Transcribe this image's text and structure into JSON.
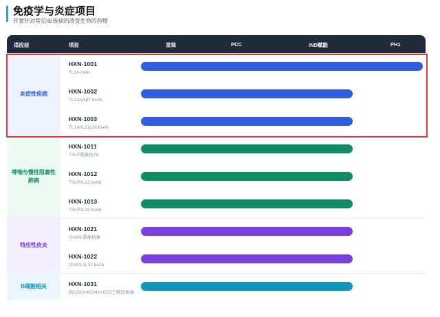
{
  "header": {
    "title": "免疫学与炎症项目",
    "subtitle": "开发针对常见I&I疾病的改变生命的药物"
  },
  "table": {
    "columns": {
      "indication": "适应症",
      "project": "项目",
      "discovery": "发现",
      "pcc": "PCC",
      "ind": "IND赋能",
      "ph1": "PH1"
    },
    "groups": [
      {
        "label": "炎症性疾病",
        "color": "#2f5fe0",
        "bg": "#eef3ff",
        "items": [
          {
            "code": "HXN-1001",
            "target": "TL1A mAb",
            "stage_progress": 1.0
          },
          {
            "code": "HXN-1002",
            "target": "TL1A/α4β7 bsAb",
            "stage_progress": 0.75
          },
          {
            "code": "HXN-1003",
            "target": "TL1A/IL23p19 bsAb",
            "stage_progress": 0.75
          }
        ]
      },
      {
        "label": "哮喘与慢性阻塞性肺病",
        "color": "#0f8c63",
        "bg": "#ecfaf3",
        "items": [
          {
            "code": "HXN-1011",
            "target": "TSLP双表位Ab",
            "stage_progress": 0.75
          },
          {
            "code": "HXN-1012",
            "target": "TSLP/IL13 bsAb",
            "stage_progress": 0.75
          },
          {
            "code": "HXN-1013",
            "target": "TSLP/IL33 bsAb",
            "stage_progress": 0.75
          }
        ]
      },
      {
        "label": "特应性皮炎",
        "color": "#7b3fe0",
        "bg": "#f4efff",
        "items": [
          {
            "code": "HXN-1021",
            "target": "OX40L单体抗体",
            "stage_progress": 0.75
          },
          {
            "code": "HXN-1022",
            "target": "OX40L/IL31 bsAb",
            "stage_progress": 0.75
          }
        ]
      },
      {
        "label": "B细胞相关",
        "color": "#1397b8",
        "bg": "#ebf7fc",
        "items": [
          {
            "code": "HXN-1031",
            "target": "抗CD19×BCMA×CD3三特异抗体",
            "stage_progress": 0.75
          }
        ]
      }
    ]
  },
  "colors": {
    "header_bg": "#1f2a3a",
    "highlight_border": "#e53935",
    "title_accent": "#2aa6c9"
  }
}
